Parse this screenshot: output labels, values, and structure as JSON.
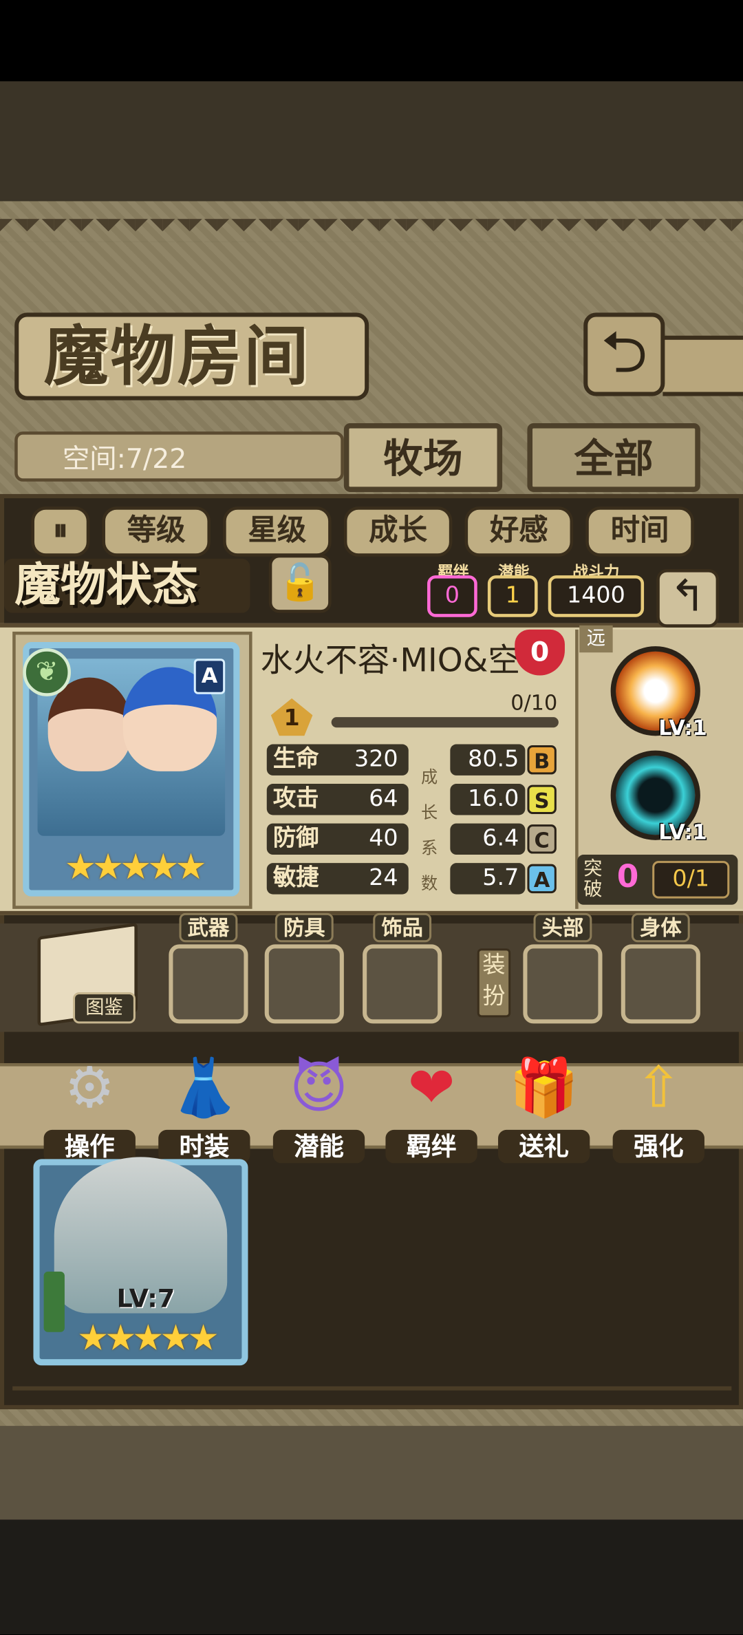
{
  "header": {
    "title": "魔物房间",
    "back_icon": "back-arrow-icon"
  },
  "storage": {
    "space_label": "空间:7/22"
  },
  "tabs": [
    {
      "label": "牧场",
      "active": true
    },
    {
      "label": "全部",
      "active": false
    }
  ],
  "filters": {
    "sort_icon": "sort-toggle-icon",
    "items": [
      "等级",
      "星级",
      "成长",
      "好感",
      "时间"
    ]
  },
  "status": {
    "title": "魔物状态",
    "lock_icon": "lock-icon",
    "bond_label": "羁绊",
    "bond_value": "0",
    "potential_label": "潜能",
    "potential_value": "1",
    "power_label": "战斗力",
    "power_value": "1400",
    "back_icon": "back-arrow-icon"
  },
  "monster": {
    "name": "水火不容·MIO&空",
    "affection": "0",
    "element_icon": "leaf-icon",
    "rank": "A",
    "stars": "★★★★★",
    "level": "1",
    "exp_text": "0/10",
    "exp_progress": 0,
    "stats": [
      {
        "label": "生命",
        "value": "320"
      },
      {
        "label": "攻击",
        "value": "64"
      },
      {
        "label": "防御",
        "value": "40"
      },
      {
        "label": "敏捷",
        "value": "24"
      }
    ],
    "growth_caption": [
      "成",
      "长",
      "系",
      "数"
    ],
    "growth": [
      {
        "value": "80.5",
        "grade": "B"
      },
      {
        "value": "16.0",
        "grade": "S"
      },
      {
        "value": "6.4",
        "grade": "C"
      },
      {
        "value": "5.7",
        "grade": "A"
      }
    ]
  },
  "skills": {
    "range": "远",
    "items": [
      {
        "icon": "explosion-skill-icon",
        "level": "LV:1"
      },
      {
        "icon": "vortex-skill-icon",
        "level": "LV:1"
      }
    ],
    "breakthrough_label": "突破",
    "breakthrough_value": "0",
    "breakthrough_fraction": "0/1"
  },
  "equipment": {
    "book_label": "图鉴",
    "slots": [
      "武器",
      "防具",
      "饰品"
    ],
    "dress_label": "装扮",
    "dress_slots": [
      "头部",
      "身体"
    ]
  },
  "actions": [
    {
      "label": "操作",
      "icon": "gear-icon"
    },
    {
      "label": "时装",
      "icon": "outfit-icon"
    },
    {
      "label": "潜能",
      "icon": "demon-icon"
    },
    {
      "label": "羁绊",
      "icon": "hearts-icon"
    },
    {
      "label": "送礼",
      "icon": "gift-icon"
    },
    {
      "label": "强化",
      "icon": "upgrade-arrows-icon"
    }
  ],
  "list": {
    "card_level": "LV:7",
    "card_stars": "★★★★★",
    "card_icon": "sword-icon"
  }
}
